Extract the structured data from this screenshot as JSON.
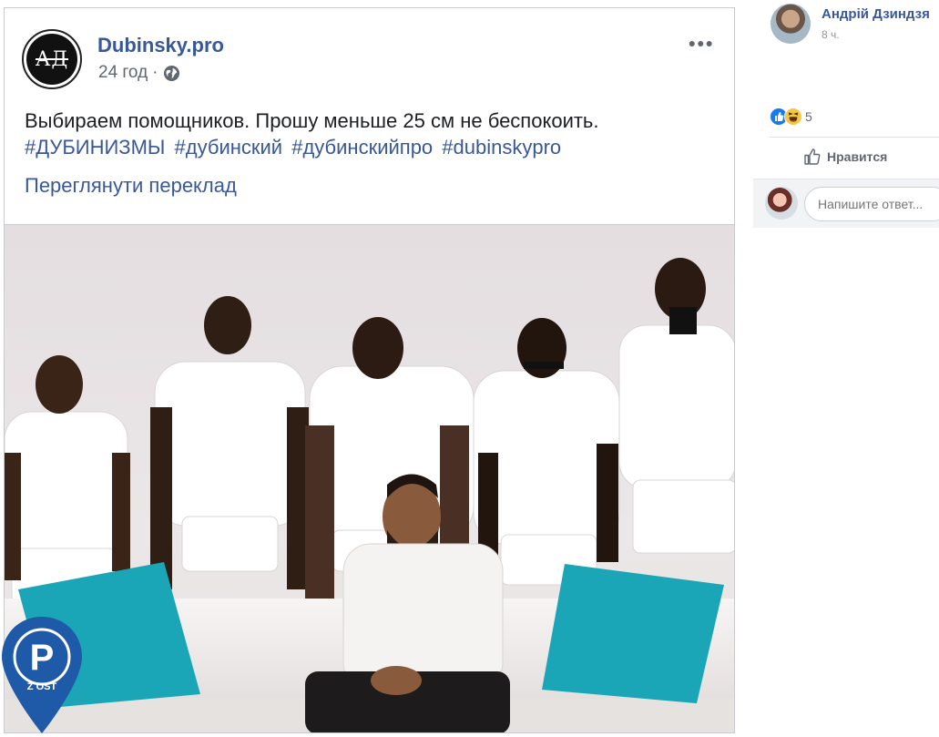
{
  "post": {
    "page_name": "Dubinsky.pro",
    "avatar_text": "АД",
    "time": "24 год",
    "separator": "·",
    "text": "Выбираем помощников. Прошу меньше 25 см не беспокоить.",
    "hashtags": [
      "#ДУБИНИЗМЫ",
      "#дубинский",
      "#дубинскийпро",
      "#dubinskypro"
    ],
    "translate_link": "Переглянути переклад",
    "more_icon": "more-horizontal-icon"
  },
  "image_watermark": {
    "letters": "P",
    "small_text": "Z OST",
    "color": "#1e5aa8"
  },
  "comment": {
    "author": "Андрій Дзиндзя",
    "time": "8 ч.",
    "reaction_count": "5",
    "reaction_icons": [
      "like-icon",
      "haha-icon"
    ],
    "like_label": "Нравится",
    "reply_placeholder": "Напишите ответ..."
  },
  "colors": {
    "link": "#385898",
    "text": "#1c1e21",
    "meta": "#606770",
    "like_blue": "#1877f2",
    "haha_yellow": "#f7c744",
    "pillow_teal": "#1aa6b7"
  }
}
